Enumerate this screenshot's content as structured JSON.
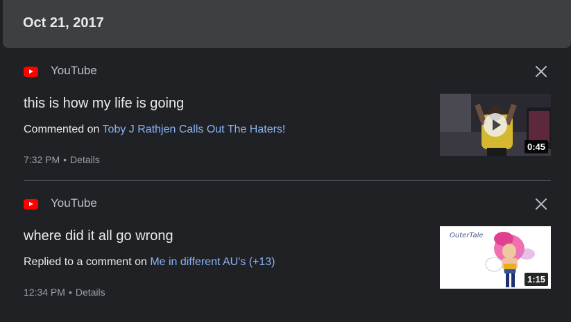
{
  "date_header": "Oct 21, 2017",
  "cards": [
    {
      "app": "YouTube",
      "app_icon": "youtube-icon",
      "title": "this is how my life is going",
      "action_prefix": "Commented on ",
      "action_link": "Toby J Rathjen Calls Out The Haters!",
      "time": "7:32 PM",
      "separator": "•",
      "details": "Details",
      "thumbnail": {
        "duration": "0:45",
        "has_play_overlay": true
      }
    },
    {
      "app": "YouTube",
      "app_icon": "youtube-icon",
      "title": "where did it all go wrong",
      "action_prefix": "Replied to a comment on ",
      "action_link": "Me in different AU's (+13)",
      "time": "12:34 PM",
      "separator": "•",
      "details": "Details",
      "thumbnail": {
        "duration": "1:15",
        "caption": "OuterTale"
      }
    }
  ],
  "colors": {
    "background": "#202124",
    "header": "#3c4043",
    "link": "#8ab4f8",
    "youtube_red": "#ff0000"
  }
}
